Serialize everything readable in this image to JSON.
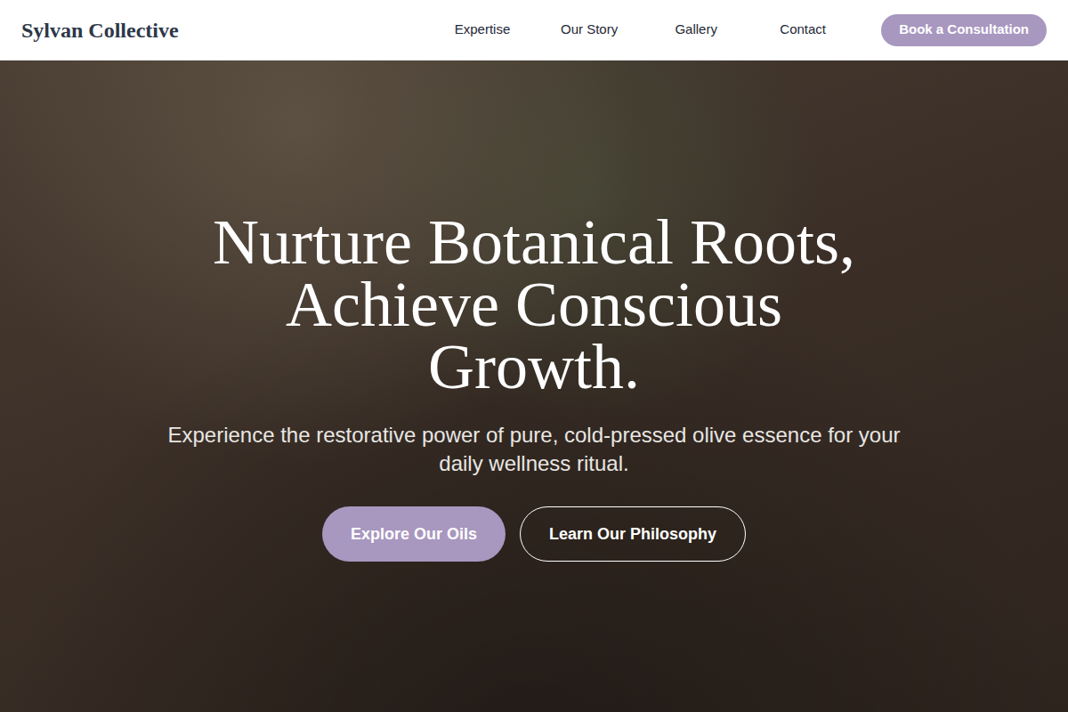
{
  "nav": {
    "logo": "Sylvan Collective",
    "links": [
      {
        "label": "Expertise"
      },
      {
        "label": "Our Story"
      },
      {
        "label": "Gallery"
      },
      {
        "label": "Contact"
      }
    ],
    "cta": "Book a Consultation"
  },
  "hero": {
    "heading_lines": [
      "Nurture Botanical Roots,",
      "Achieve Conscious",
      "Growth."
    ],
    "subtitle": "Experience the restorative power of pure, cold-pressed olive essence for your daily wellness ritual.",
    "primary_button": "Explore Our Oils",
    "secondary_button": "Learn Our Philosophy"
  }
}
